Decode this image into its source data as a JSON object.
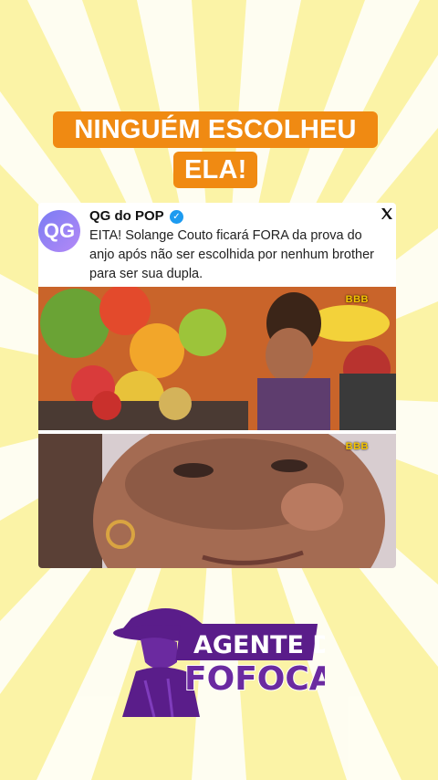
{
  "headline": {
    "line1": "NINGUÉM ESCOLHEU",
    "line2": "ELA!"
  },
  "tweet": {
    "avatar_text": "QG",
    "author": "QG do POP",
    "verified": "✓",
    "text": "EITA! Solange Couto ficará FORA da prova do anjo após não ser escolhida por nenhum brother para ser sua dupla."
  },
  "photos": {
    "watermark_1": "BBB",
    "watermark_2": "BBB"
  },
  "logo": {
    "line1": "AGENTE DA",
    "line2": "FOFOCA"
  },
  "colors": {
    "accent": "#f08a12",
    "brand_purple": "#5a1d8a",
    "background": "#fbf4b8"
  }
}
